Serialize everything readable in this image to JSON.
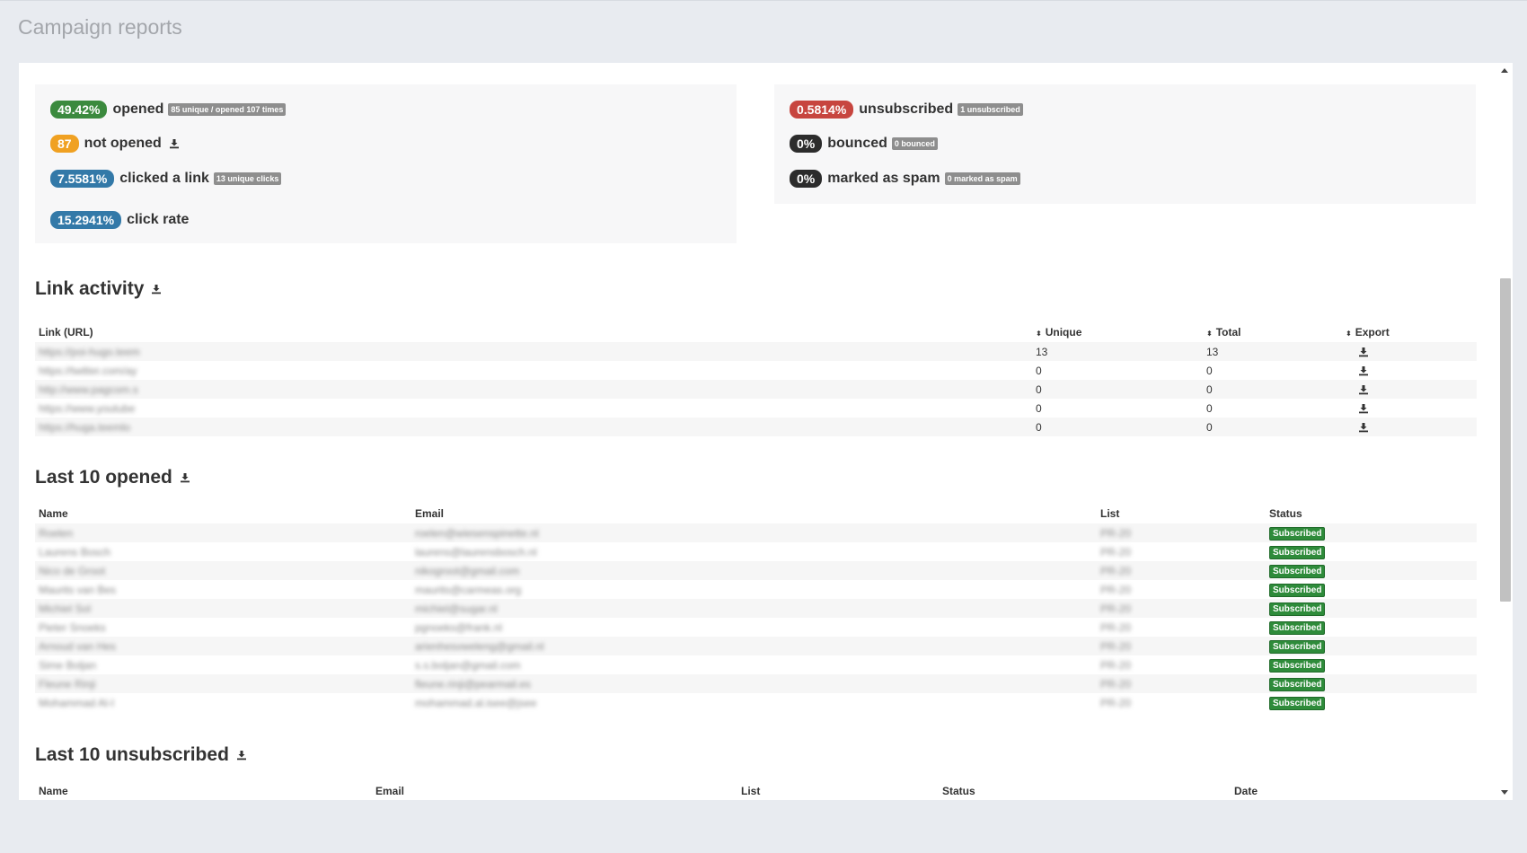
{
  "page": {
    "title": "Campaign reports"
  },
  "stats_left": [
    {
      "value": "49.42%",
      "label": "opened",
      "tag": "85 unique / opened 107 times",
      "color": "green"
    },
    {
      "value": "87",
      "label": "not opened",
      "color": "orange",
      "icon": "download-icon"
    },
    {
      "value": "7.5581%",
      "label": "clicked a link",
      "tag": "13 unique clicks",
      "color": "blue"
    },
    {
      "value": "15.2941%",
      "label": "click rate",
      "color": "blue"
    }
  ],
  "stats_right": [
    {
      "value": "0.5814%",
      "label": "unsubscribed",
      "tag": "1 unsubscribed",
      "color": "red"
    },
    {
      "value": "0%",
      "label": "bounced",
      "tag": "0 bounced",
      "color": "dark"
    },
    {
      "value": "0%",
      "label": "marked as spam",
      "tag": "0 marked as spam",
      "color": "dark"
    }
  ],
  "link_activity": {
    "title": "Link activity",
    "headers": {
      "link": "Link (URL)",
      "unique": "Unique",
      "total": "Total",
      "export": "Export"
    },
    "rows": [
      {
        "url": "https://poi-hugo.teem",
        "unique": "13",
        "total": "13"
      },
      {
        "url": "https://twitter.com/ay",
        "unique": "0",
        "total": "0"
      },
      {
        "url": "http://www.pagcom.s",
        "unique": "0",
        "total": "0"
      },
      {
        "url": "https://www.youtube",
        "unique": "0",
        "total": "0"
      },
      {
        "url": "https://huga.teemlo",
        "unique": "0",
        "total": "0"
      }
    ]
  },
  "last_opened": {
    "title": "Last 10 opened",
    "headers": {
      "name": "Name",
      "email": "Email",
      "list": "List",
      "status": "Status"
    },
    "rows": [
      {
        "name": "Roelen",
        "email": "roelen@wiesenspinette.nl",
        "list": "PR-20",
        "status": "Subscribed"
      },
      {
        "name": "Laurens Bosch",
        "email": "laurens@laurensbosch.nl",
        "list": "PR-20",
        "status": "Subscribed"
      },
      {
        "name": "Nico de Groot",
        "email": "nikogroot@gmail.com",
        "list": "PR-20",
        "status": "Subscribed"
      },
      {
        "name": "Maurits van Bes",
        "email": "maurits@carmeas.org",
        "list": "PR-20",
        "status": "Subscribed"
      },
      {
        "name": "Michiel Sol",
        "email": "michiel@sugar.nl",
        "list": "PR-20",
        "status": "Subscribed"
      },
      {
        "name": "Pieter Snoeks",
        "email": "pgnoeks@frank.nl",
        "list": "PR-20",
        "status": "Subscribed"
      },
      {
        "name": "Arnoud van Hes",
        "email": "arienhesvweleng@gmail.nl",
        "list": "PR-20",
        "status": "Subscribed"
      },
      {
        "name": "Sime Boljan",
        "email": "s.s.boljan@gmail.com",
        "list": "PR-20",
        "status": "Subscribed"
      },
      {
        "name": "Fleune Rinji",
        "email": "fleune.rinji@pearmail.es",
        "list": "PR-20",
        "status": "Subscribed"
      },
      {
        "name": "Mohammad Al-I",
        "email": "mohammad.al.isee@jsee",
        "list": "PR-20",
        "status": "Subscribed"
      }
    ]
  },
  "last_unsubscribed": {
    "title": "Last 10 unsubscribed",
    "headers": {
      "name": "Name",
      "email": "Email",
      "list": "List",
      "status": "Status",
      "date": "Date"
    }
  }
}
